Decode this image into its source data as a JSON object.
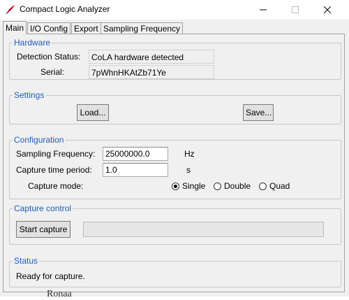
{
  "window": {
    "icon": "tk-feather-icon",
    "title": "Compact Logic Analyzer"
  },
  "tabs": [
    {
      "label": "Main",
      "active": true
    },
    {
      "label": "I/O Config",
      "active": false
    },
    {
      "label": "Export",
      "active": false
    },
    {
      "label": "Sampling Frequency",
      "active": false
    }
  ],
  "hardware": {
    "title": "Hardware",
    "detection_label": "Detection Status:",
    "detection_value": "CoLA hardware detected",
    "serial_label": "Serial:",
    "serial_value": "7pWhnHKAtZb71Ye"
  },
  "settings": {
    "title": "Settings",
    "load_label": "Load...",
    "save_label": "Save..."
  },
  "configuration": {
    "title": "Configuration",
    "sampling_label": "Sampling Frequency:",
    "sampling_value": "25000000.0",
    "sampling_unit": "Hz",
    "capture_time_label": "Capture time period:",
    "capture_time_value": "1.0",
    "capture_time_unit": "s",
    "mode_label": "Capture mode:",
    "modes": [
      {
        "label": "Single",
        "selected": true
      },
      {
        "label": "Double",
        "selected": false
      },
      {
        "label": "Quad",
        "selected": false
      }
    ]
  },
  "capture_control": {
    "title": "Capture control",
    "start_label": "Start capture",
    "progress": 0
  },
  "status": {
    "title": "Status",
    "text": "Ready for capture."
  },
  "background_text": "Ronaa"
}
